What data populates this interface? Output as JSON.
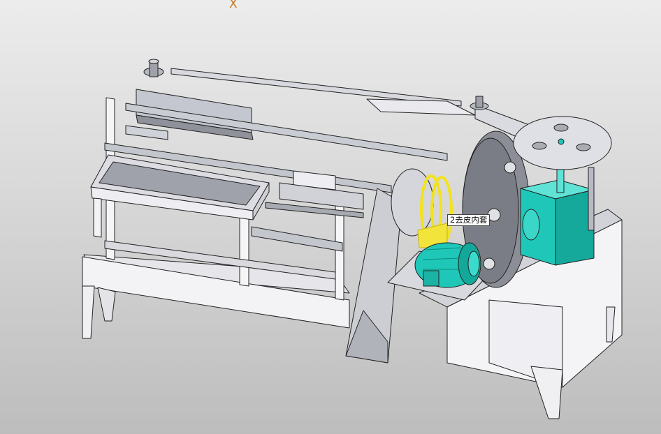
{
  "viewport": {
    "axis_label": "X",
    "callout_label": "2去皮内套"
  },
  "colors": {
    "frame": "#f2f2f5",
    "outline": "#222222",
    "metal": "#bfc3cc",
    "dark_metal": "#6d7077",
    "motor": "#1fc7b8",
    "highlight": "#f4e21a"
  }
}
